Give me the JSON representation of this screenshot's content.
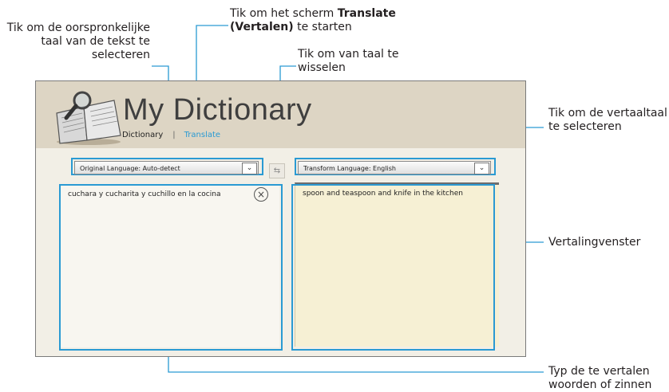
{
  "callouts": {
    "source_lang": [
      "Tik om de oorspronkelijke",
      "taal van de tekst te",
      "selecteren"
    ],
    "translate_screen": {
      "pre": "Tik om het scherm ",
      "bold1": "Translate",
      "bold2": "(Vertalen)",
      "post": " te starten"
    },
    "swap": [
      "Tik om van taal te",
      "wisselen"
    ],
    "target_lang": [
      "Tik om de vertaaltaal",
      "te selecteren"
    ],
    "translation_window": "Vertalingvenster",
    "input": [
      "Typ de te vertalen",
      "woorden of zinnen"
    ]
  },
  "app": {
    "title": "My Dictionary",
    "nav": {
      "dictionary": "Dictionary",
      "separator": "|",
      "translate": "Translate"
    },
    "original_language": "Original Language: Auto-detect",
    "transform_language": "Transform Language: English",
    "source_text": "cuchara y cucharita y cuchillo en la cocina",
    "translated_text": "spoon and teaspoon and knife in the kitchen",
    "colors": {
      "highlight": "#2a9ad3",
      "header": "#ddd5c4",
      "translation_bg": "#f6f0d4"
    }
  }
}
